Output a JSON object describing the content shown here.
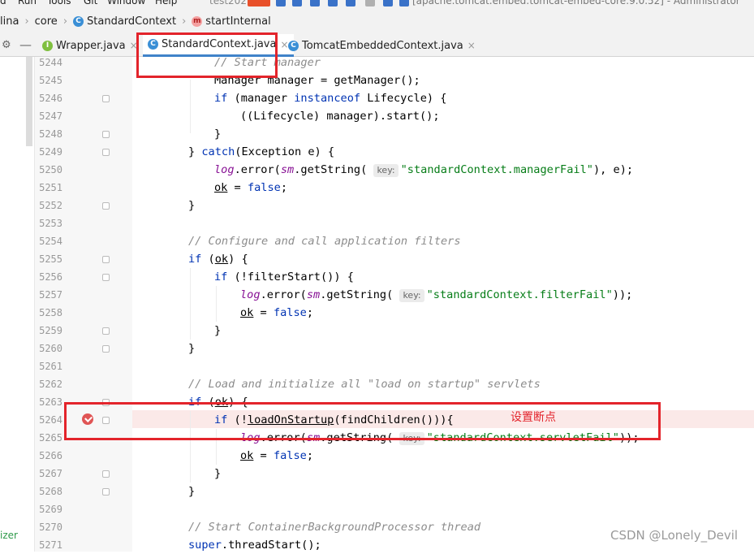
{
  "menubar": {
    "items": [
      "d",
      "Run",
      "Tools",
      "Git",
      "Window",
      "Help"
    ],
    "project": "test2021",
    "title": "[apache.tomcat.embed:tomcat-embed-core:9.0.52] - Administrator"
  },
  "breadcrumb": {
    "items": [
      {
        "label": "lina",
        "icon": ""
      },
      {
        "label": "core",
        "icon": ""
      },
      {
        "label": "StandardContext",
        "icon": "C"
      },
      {
        "label": "startInternal",
        "icon": "m"
      }
    ]
  },
  "tabs": [
    {
      "label": "Wrapper.java",
      "icon": "I",
      "active": false
    },
    {
      "label": "StandardContext.java",
      "icon": "C",
      "active": true
    },
    {
      "label": "TomcatEmbeddedContext.java",
      "icon": "C",
      "active": false
    }
  ],
  "tab_close": "×",
  "editor": {
    "lines": [
      {
        "n": "5244",
        "t": "// Start manager"
      },
      {
        "n": "5245",
        "t": "Manager manager = getManager();"
      },
      {
        "n": "5246",
        "t": "if (manager instanceof Lifecycle) {"
      },
      {
        "n": "5247",
        "t": "((Lifecycle) manager).start();"
      },
      {
        "n": "5248",
        "t": "}"
      },
      {
        "n": "5249",
        "t": "} catch(Exception e) {"
      },
      {
        "n": "5250",
        "t": "log.error(sm.getString( key: \"standardContext.managerFail\"), e);"
      },
      {
        "n": "5251",
        "t": "ok = false;"
      },
      {
        "n": "5252",
        "t": "}"
      },
      {
        "n": "5253",
        "t": ""
      },
      {
        "n": "5254",
        "t": "// Configure and call application filters"
      },
      {
        "n": "5255",
        "t": "if (ok) {"
      },
      {
        "n": "5256",
        "t": "if (!filterStart()) {"
      },
      {
        "n": "5257",
        "t": "log.error(sm.getString( key: \"standardContext.filterFail\"));"
      },
      {
        "n": "5258",
        "t": "ok = false;"
      },
      {
        "n": "5259",
        "t": "}"
      },
      {
        "n": "5260",
        "t": "}"
      },
      {
        "n": "5261",
        "t": ""
      },
      {
        "n": "5262",
        "t": "// Load and initialize all \"load on startup\" servlets"
      },
      {
        "n": "5263",
        "t": "if (ok) {"
      },
      {
        "n": "5264",
        "t": "if (!loadOnStartup(findChildren())){"
      },
      {
        "n": "5265",
        "t": "log.error(sm.getString( key: \"standardContext.servletFail\"));"
      },
      {
        "n": "5266",
        "t": "ok = false;"
      },
      {
        "n": "5267",
        "t": "}"
      },
      {
        "n": "5268",
        "t": "}"
      },
      {
        "n": "5269",
        "t": ""
      },
      {
        "n": "5270",
        "t": "// Start ContainerBackgroundProcessor thread"
      },
      {
        "n": "5271",
        "t": "super.threadStart();"
      }
    ]
  },
  "annotation": "设置断点",
  "watermark": "CSDN @Lonely_Devil",
  "side_text": "izer",
  "colors": {
    "highlight": "#e3242b",
    "breakpoint": "#e05555",
    "tab_underline": "#4083c9"
  }
}
